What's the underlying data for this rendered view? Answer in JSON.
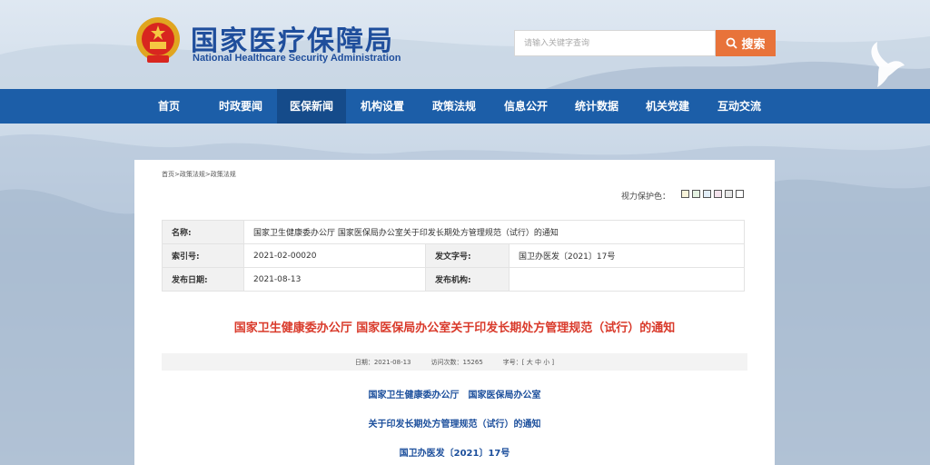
{
  "header": {
    "title_cn": "国家医疗保障局",
    "title_en": "National Healthcare Security Administration",
    "search_placeholder": "请输入关键字查询",
    "search_button": "搜索"
  },
  "nav": {
    "items": [
      {
        "label": "首页"
      },
      {
        "label": "时政要闻"
      },
      {
        "label": "医保新闻"
      },
      {
        "label": "机构设置"
      },
      {
        "label": "政策法规"
      },
      {
        "label": "信息公开"
      },
      {
        "label": "统计数据"
      },
      {
        "label": "机关党建"
      },
      {
        "label": "互动交流"
      }
    ],
    "active_index": 2
  },
  "breadcrumb": "首页>政策法规>政策法规",
  "vision": {
    "label": "视力保护色：",
    "colors": [
      "#f8f3d9",
      "#e5f3e2",
      "#e2eef8",
      "#f4e2ec",
      "#e7e7e7",
      "#ffffff"
    ]
  },
  "info": {
    "name_label": "名称:",
    "name_value": "国家卫生健康委办公厅 国家医保局办公室关于印发长期处方管理规范（试行）的通知",
    "index_label": "索引号:",
    "index_value": "2021-02-00020",
    "doc_no_label": "发文字号:",
    "doc_no_value": "国卫办医发〔2021〕17号",
    "date_label": "发布日期:",
    "date_value": "2021-08-13",
    "org_label": "发布机构:",
    "org_value": ""
  },
  "article": {
    "title": "国家卫生健康委办公厅 国家医保局办公室关于印发长期处方管理规范（试行）的通知",
    "meta_date": "日期：2021-08-13",
    "meta_visits": "访问次数：15265",
    "meta_font": "字号：[ 大 中 小 ]",
    "line1": "国家卫生健康委办公厅　国家医保局办公室",
    "line2": "关于印发长期处方管理规范（试行）的通知",
    "line3": "国卫办医发〔2021〕17号"
  }
}
